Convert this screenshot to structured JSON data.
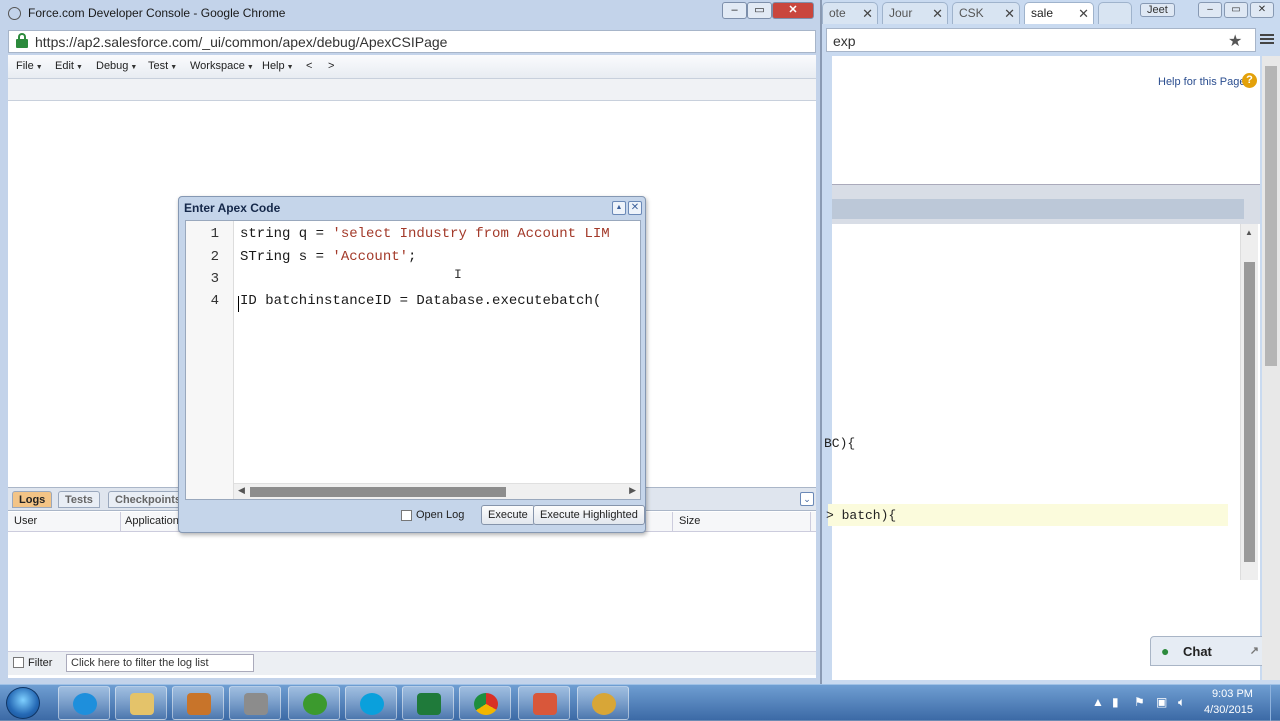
{
  "background_window": {
    "tabs": [
      {
        "label": "ote"
      },
      {
        "label": "Jour"
      },
      {
        "label": "CSK"
      },
      {
        "label": "sale"
      }
    ],
    "profile_label": "Jeet",
    "address_fragment": "exp",
    "help_link": "Help for this Page",
    "code_fragment_1": "BC){",
    "code_fragment_2": "> batch){",
    "chat_label": "Chat"
  },
  "console_window": {
    "title": "Force.com Developer Console - Google Chrome",
    "url": "https://ap2.salesforce.com/_ui/common/apex/debug/ApexCSIPage",
    "menu": [
      {
        "label": "File"
      },
      {
        "label": "Edit"
      },
      {
        "label": "Debug"
      },
      {
        "label": "Test"
      },
      {
        "label": "Workspace"
      },
      {
        "label": "Help"
      }
    ],
    "nav_back": "<",
    "nav_forward": ">",
    "log_tabs": [
      {
        "label": "Logs",
        "active": true
      },
      {
        "label": "Tests",
        "active": false
      },
      {
        "label": "Checkpoints",
        "active": false
      }
    ],
    "log_columns": [
      "User",
      "Application",
      "Size"
    ],
    "filter_label": "Filter",
    "filter_value": "Click here to filter the log list"
  },
  "apex_dialog": {
    "title": "Enter Apex Code",
    "line_numbers": [
      "1",
      "2",
      "3",
      "4"
    ],
    "lines": [
      {
        "pre": "string q = ",
        "str": "'select Industry from Account LIM",
        "post": ""
      },
      {
        "pre": "STring s = ",
        "str": "'Account'",
        "post": ";"
      },
      {
        "pre": "",
        "str": "",
        "post": ""
      },
      {
        "pre": "ID batchinstanceID = Database.executebatch(",
        "str": "",
        "post": ""
      }
    ],
    "open_log_label": "Open Log",
    "execute_label": "Execute",
    "execute_highlighted_label": "Execute Highlighted"
  },
  "taskbar": {
    "apps": [
      "ie-icon",
      "file-explorer-icon",
      "media-player-icon",
      "app-icon",
      "utorrent-icon",
      "skype-icon",
      "excel-icon",
      "chrome-icon",
      "paint-icon",
      "flower-app-icon"
    ],
    "time": "9:03 PM",
    "date": "4/30/2015"
  }
}
